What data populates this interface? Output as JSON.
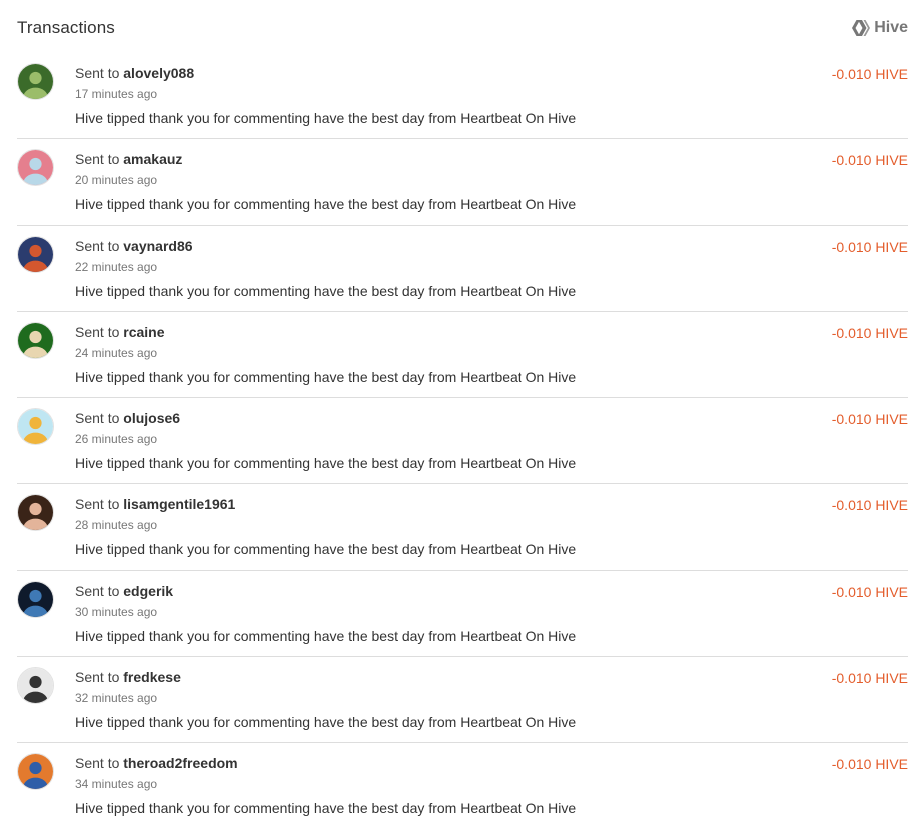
{
  "header": {
    "title": "Transactions",
    "network_label": "Hive",
    "network_icon": "hive-logo-icon"
  },
  "colors": {
    "amount_negative": "#e35d2c",
    "divider": "#dddddd",
    "muted_text": "#777777"
  },
  "transactions": [
    {
      "prefix": "Sent to",
      "user": "alovely088",
      "time": "17 minutes ago",
      "memo": "Hive tipped thank you for commenting have the best day from Heartbeat On Hive",
      "amount": "-0.010 HIVE",
      "avatar_colors": [
        "#3b6b2a",
        "#9bbd6a"
      ]
    },
    {
      "prefix": "Sent to",
      "user": "amakauz",
      "time": "20 minutes ago",
      "memo": "Hive tipped thank you for commenting have the best day from Heartbeat On Hive",
      "amount": "-0.010 HIVE",
      "avatar_colors": [
        "#e57f8e",
        "#b8d8e8"
      ]
    },
    {
      "prefix": "Sent to",
      "user": "vaynard86",
      "time": "22 minutes ago",
      "memo": "Hive tipped thank you for commenting have the best day from Heartbeat On Hive",
      "amount": "-0.010 HIVE",
      "avatar_colors": [
        "#2b3c6e",
        "#d3572f"
      ]
    },
    {
      "prefix": "Sent to",
      "user": "rcaine",
      "time": "24 minutes ago",
      "memo": "Hive tipped thank you for commenting have the best day from Heartbeat On Hive",
      "amount": "-0.010 HIVE",
      "avatar_colors": [
        "#1f6b1e",
        "#e8d6b0"
      ]
    },
    {
      "prefix": "Sent to",
      "user": "olujose6",
      "time": "26 minutes ago",
      "memo": "Hive tipped thank you for commenting have the best day from Heartbeat On Hive",
      "amount": "-0.010 HIVE",
      "avatar_colors": [
        "#bfe6f2",
        "#f0b43a"
      ]
    },
    {
      "prefix": "Sent to",
      "user": "lisamgentile1961",
      "time": "28 minutes ago",
      "memo": "Hive tipped thank you for commenting have the best day from Heartbeat On Hive",
      "amount": "-0.010 HIVE",
      "avatar_colors": [
        "#3a2418",
        "#e3b49a"
      ]
    },
    {
      "prefix": "Sent to",
      "user": "edgerik",
      "time": "30 minutes ago",
      "memo": "Hive tipped thank you for commenting have the best day from Heartbeat On Hive",
      "amount": "-0.010 HIVE",
      "avatar_colors": [
        "#0f1a2c",
        "#3f79b5"
      ]
    },
    {
      "prefix": "Sent to",
      "user": "fredkese",
      "time": "32 minutes ago",
      "memo": "Hive tipped thank you for commenting have the best day from Heartbeat On Hive",
      "amount": "-0.010 HIVE",
      "avatar_colors": [
        "#e8e8e8",
        "#333333"
      ]
    },
    {
      "prefix": "Sent to",
      "user": "theroad2freedom",
      "time": "34 minutes ago",
      "memo": "Hive tipped thank you for commenting have the best day from Heartbeat On Hive",
      "amount": "-0.010 HIVE",
      "avatar_colors": [
        "#e37a2e",
        "#2f5ea8"
      ]
    }
  ]
}
